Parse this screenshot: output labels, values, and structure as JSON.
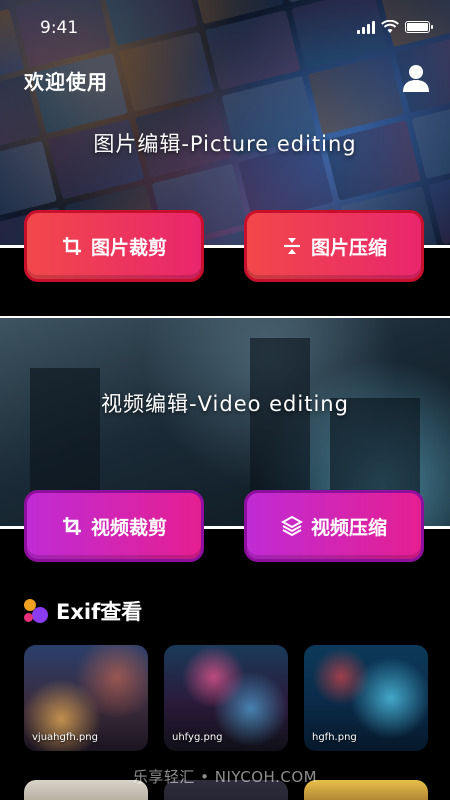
{
  "status_bar": {
    "time": "9:41",
    "battery_level": 1.0
  },
  "header": {
    "welcome": "欢迎使用",
    "profile_icon": "user-icon"
  },
  "picture": {
    "title": "图片编辑-Picture editing",
    "crop_label": "图片裁剪",
    "compress_label": "图片压缩",
    "crop_icon": "crop-icon",
    "compress_icon": "compress-icon"
  },
  "video": {
    "title": "视频编辑-Video editing",
    "crop_label": "视频裁剪",
    "compress_label": "视频压缩",
    "crop_icon": "crop-icon",
    "compress_icon": "layers-icon"
  },
  "exif": {
    "title": "Exif查看",
    "images": [
      {
        "name": "vjuahgfh.png"
      },
      {
        "name": "uhfyg.png"
      },
      {
        "name": "hgfh.png"
      }
    ]
  },
  "watermark": "乐享轻汇 • NIYCOH.COM",
  "colors": {
    "picture_button": "#ef3a58",
    "picture_button_border": "#c8102c",
    "video_button": "#cf27b5",
    "video_button_border": "#8e0f9e",
    "background": "#000000"
  }
}
